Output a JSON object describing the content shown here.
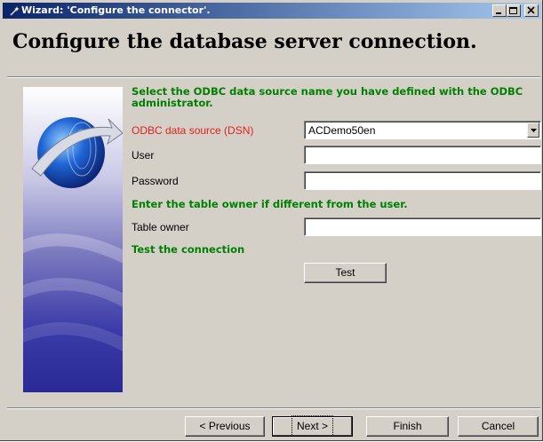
{
  "window": {
    "title": "Wizard: 'Configure the connector'.",
    "minimize_icon": "minimize-icon",
    "maximize_icon": "maximize-icon",
    "close_icon": "close-icon"
  },
  "header": {
    "title": "Configure the database server connection."
  },
  "form": {
    "intro": "Select the ODBC data source name you have defined with the ODBC administrator.",
    "dsn_label": "ODBC data source (DSN)",
    "dsn_value": "ACDemo50en",
    "user_label": "User",
    "user_value": "",
    "password_label": "Password",
    "password_value": "",
    "owner_intro": "Enter the table owner if different from the user.",
    "owner_label": "Table owner",
    "owner_value": "",
    "test_intro": "Test the connection",
    "test_button": "Test"
  },
  "footer": {
    "previous_button": "< Previous",
    "next_button": "Next >",
    "finish_button": "Finish",
    "cancel_button": "Cancel"
  },
  "colors": {
    "titlebar_start": "#0a246a",
    "titlebar_end": "#a6caf0",
    "section_text": "#008000",
    "required_label": "#e02020",
    "dialog_face": "#d4d0c8"
  }
}
